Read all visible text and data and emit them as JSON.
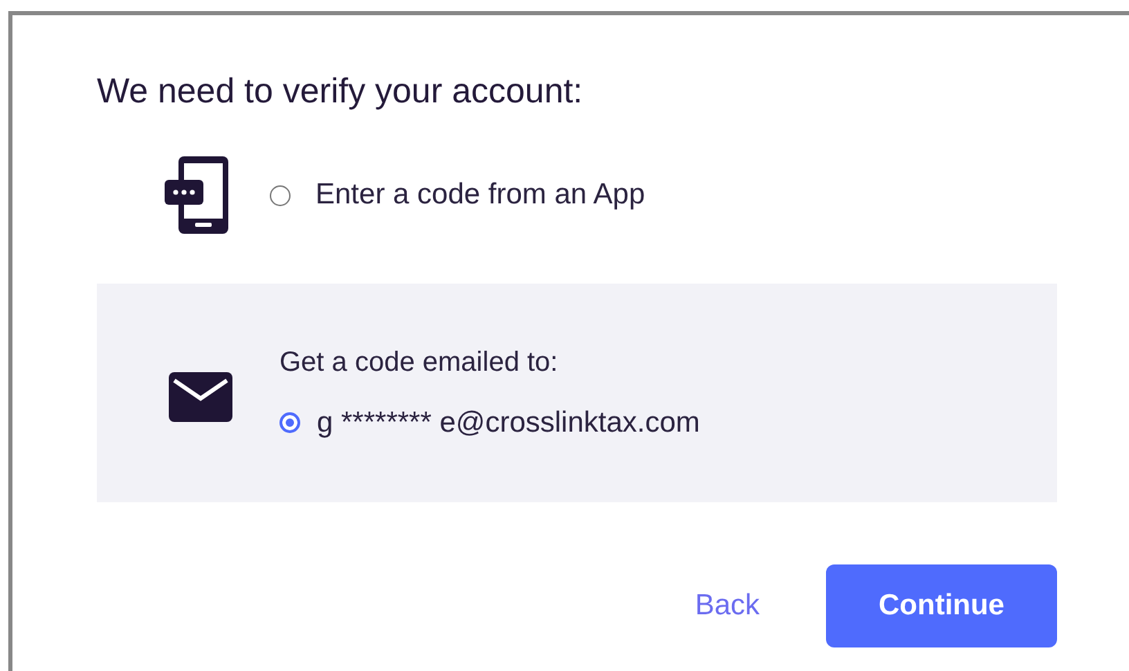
{
  "title": "We need to verify your account:",
  "options": [
    {
      "kind": "app",
      "label": "Enter a code from an App",
      "selected": false
    },
    {
      "kind": "email",
      "heading": "Get a code emailed to:",
      "label": "g ******** e@crosslinktax.com",
      "selected": true
    }
  ],
  "buttons": [
    {
      "kind": "link",
      "label": "Back"
    },
    {
      "kind": "primary",
      "label": "Continue"
    }
  ]
}
